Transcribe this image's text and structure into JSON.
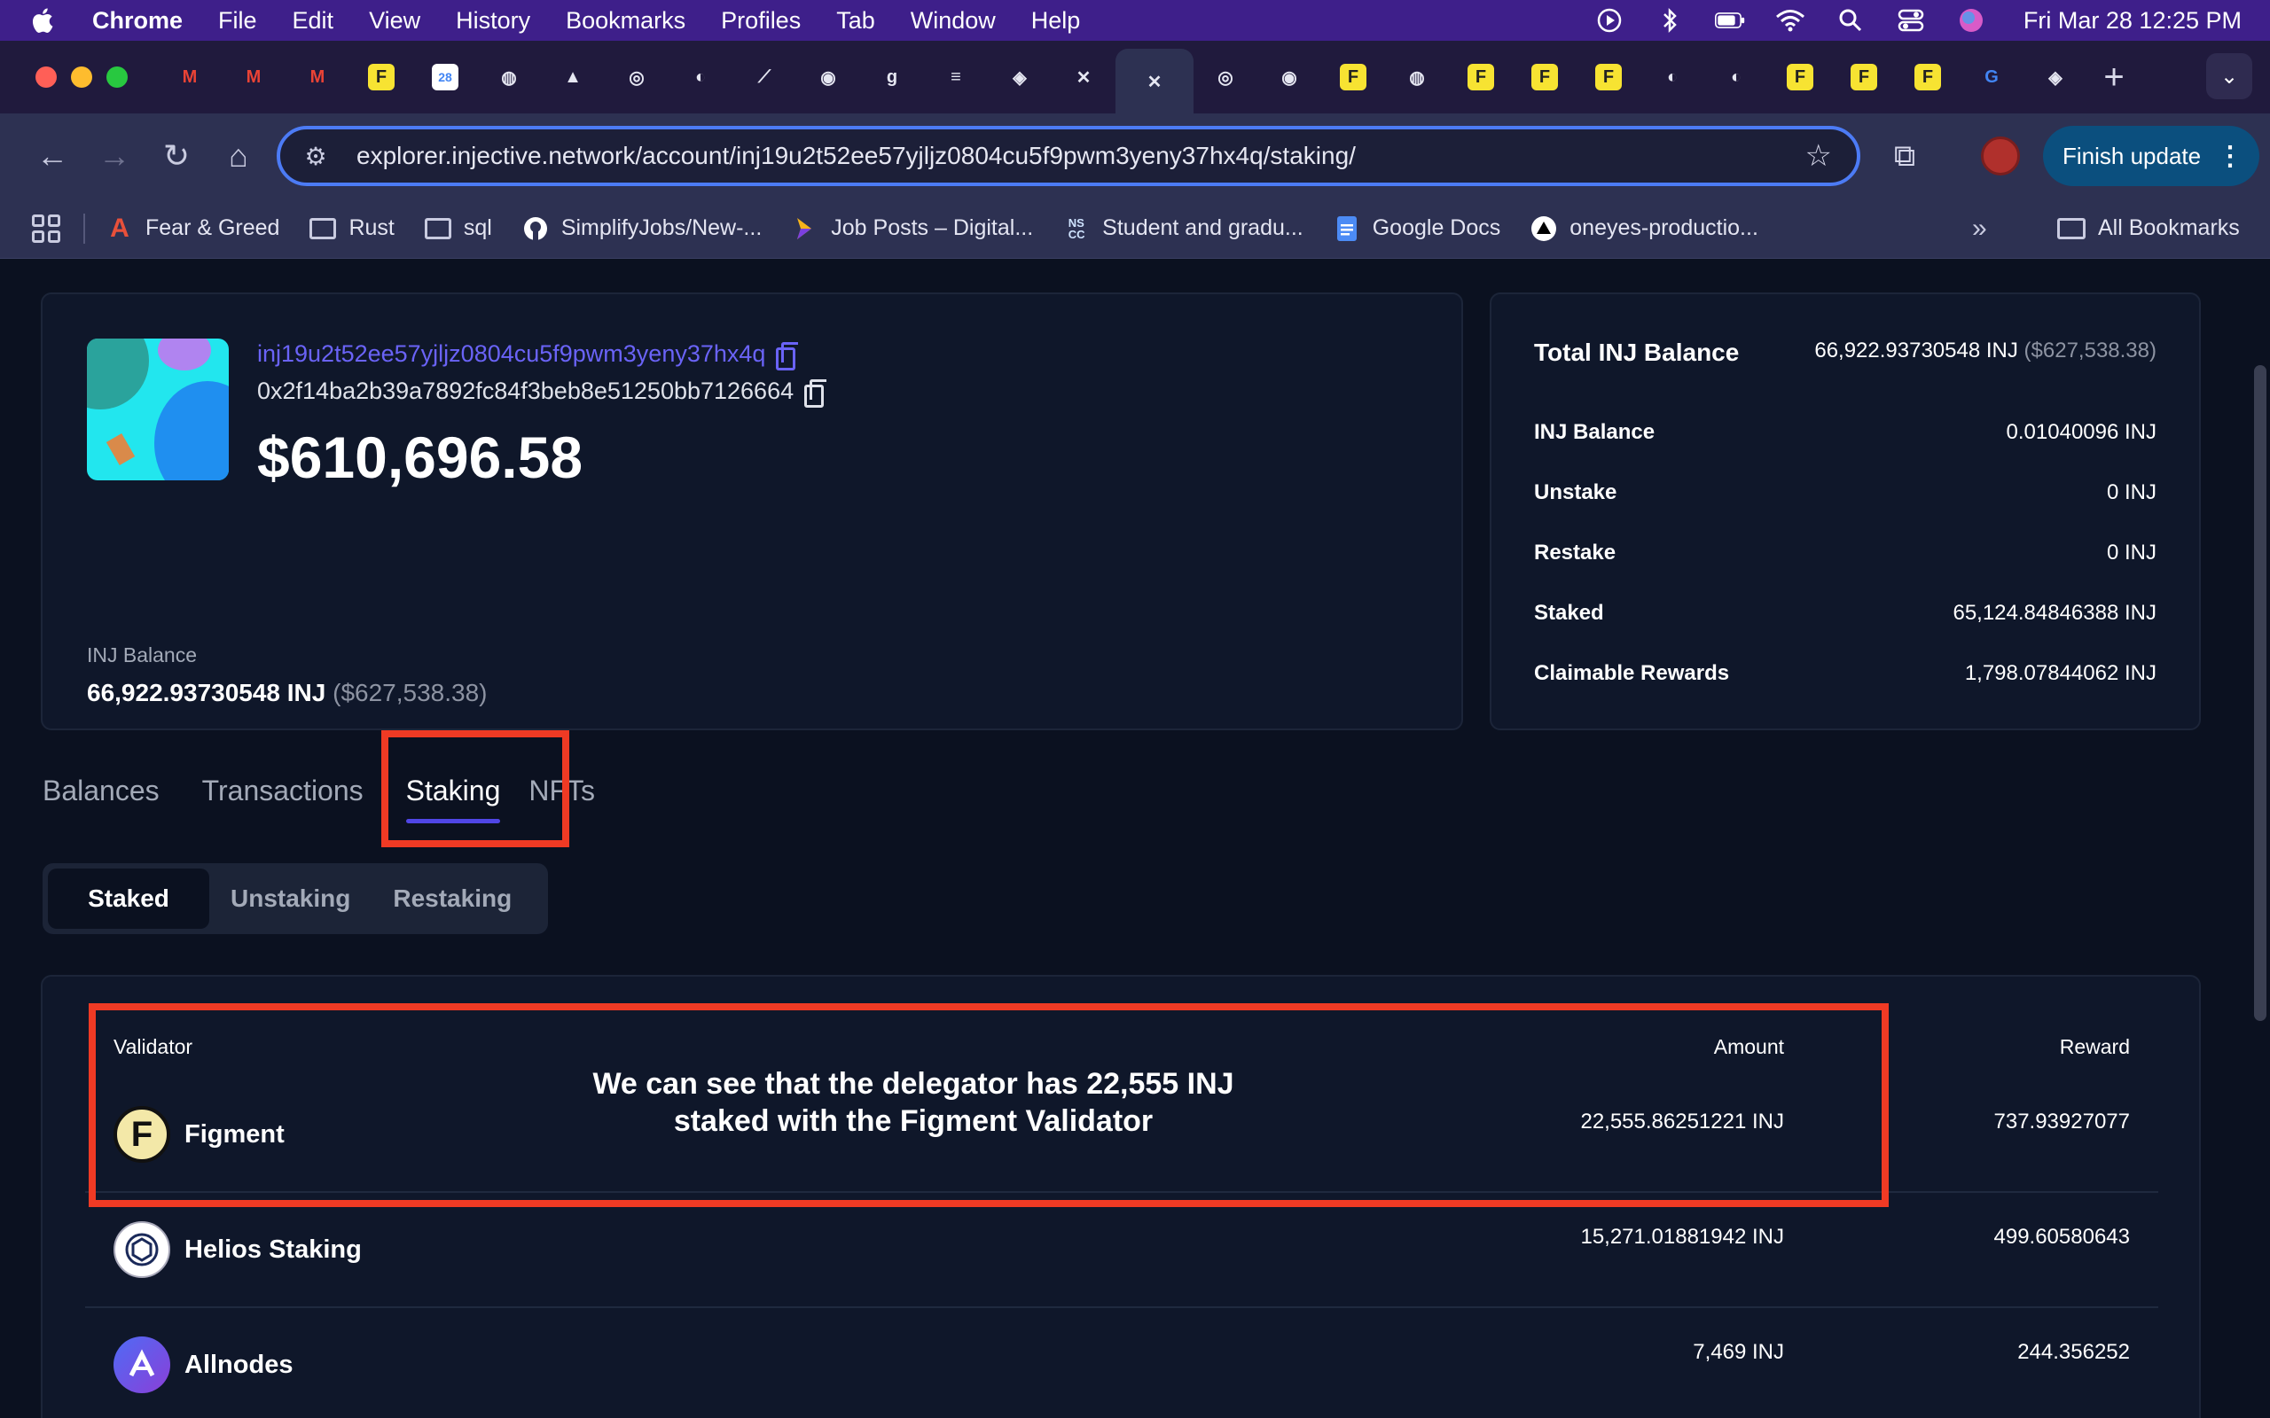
{
  "menubar": {
    "app": "Chrome",
    "items": [
      "File",
      "Edit",
      "View",
      "History",
      "Bookmarks",
      "Profiles",
      "Tab",
      "Window",
      "Help"
    ],
    "clock": "Fri Mar 28  12:25 PM"
  },
  "tabs_strip": {
    "favicons": [
      "M",
      "M",
      "M",
      "F",
      "28",
      "◍",
      "▲",
      "◎",
      "◐",
      "⟋",
      "◉",
      "g",
      "≡",
      "◈",
      "✕",
      "✕",
      "◎",
      "◉",
      "F",
      "◍",
      "F",
      "F",
      "F",
      "◐",
      "◐",
      "F",
      "F",
      "F",
      "G",
      "◈"
    ],
    "active_close": "✕"
  },
  "toolbar": {
    "url": "explorer.injective.network/account/inj19u2t52ee57yjljz0804cu5f9pwm3yeny37hx4q/staking/",
    "finish_update": "Finish update"
  },
  "bookmarks": [
    {
      "label": "Fear & Greed",
      "icon": "fear-greed-icon"
    },
    {
      "label": "Rust",
      "icon": "folder-icon"
    },
    {
      "label": "sql",
      "icon": "folder-icon"
    },
    {
      "label": "SimplifyJobs/New-...",
      "icon": "github-icon"
    },
    {
      "label": "Job Posts – Digital...",
      "icon": "arrow-icon"
    },
    {
      "label": "Student and gradu...",
      "icon": "nscc-icon"
    },
    {
      "label": "Google Docs",
      "icon": "docs-icon"
    },
    {
      "label": "oneyes-productio...",
      "icon": "triangle-icon"
    }
  ],
  "bookmarks_all": "All Bookmarks",
  "account": {
    "inj_address": "inj19u2t52ee57yjljz0804cu5f9pwm3yeny37hx4q",
    "eth_address": "0x2f14ba2b39a7892fc84f3beb8e51250bb7126664",
    "total_value": "$610,696.58",
    "balance_label": "INJ Balance",
    "balance_value": "66,922.93730548 INJ",
    "balance_usd": "($627,538.38)"
  },
  "summary": {
    "total_label": "Total INJ Balance",
    "total_value": "66,922.93730548 INJ",
    "total_usd": "($627,538.38)",
    "rows": [
      {
        "label": "INJ Balance",
        "value": "0.01040096 INJ"
      },
      {
        "label": "Unstake",
        "value": "0 INJ"
      },
      {
        "label": "Restake",
        "value": "0 INJ"
      },
      {
        "label": "Staked",
        "value": "65,124.84846388 INJ"
      },
      {
        "label": "Claimable Rewards",
        "value": "1,798.07844062 INJ"
      }
    ]
  },
  "page_tabs": [
    "Balances",
    "Transactions",
    "Staking",
    "NFTs"
  ],
  "sub_tabs": [
    "Staked",
    "Unstaking",
    "Restaking"
  ],
  "table": {
    "headers": {
      "validator": "Validator",
      "amount": "Amount",
      "reward": "Reward"
    },
    "rows": [
      {
        "name": "Figment",
        "amount": "22,555.86251221 INJ",
        "reward": "737.93927077"
      },
      {
        "name": "Helios Staking",
        "amount": "15,271.01881942 INJ",
        "reward": "499.60580643"
      },
      {
        "name": "Allnodes",
        "amount": "7,469 INJ",
        "reward": "244.356252"
      }
    ]
  },
  "annotation": {
    "line1": "We can see that the delegator has 22,555 INJ",
    "line2": "staked with the Figment Validator"
  },
  "colors": {
    "accent": "#5046e5",
    "highlight": "#ef3a24",
    "link": "#6a63f7"
  }
}
